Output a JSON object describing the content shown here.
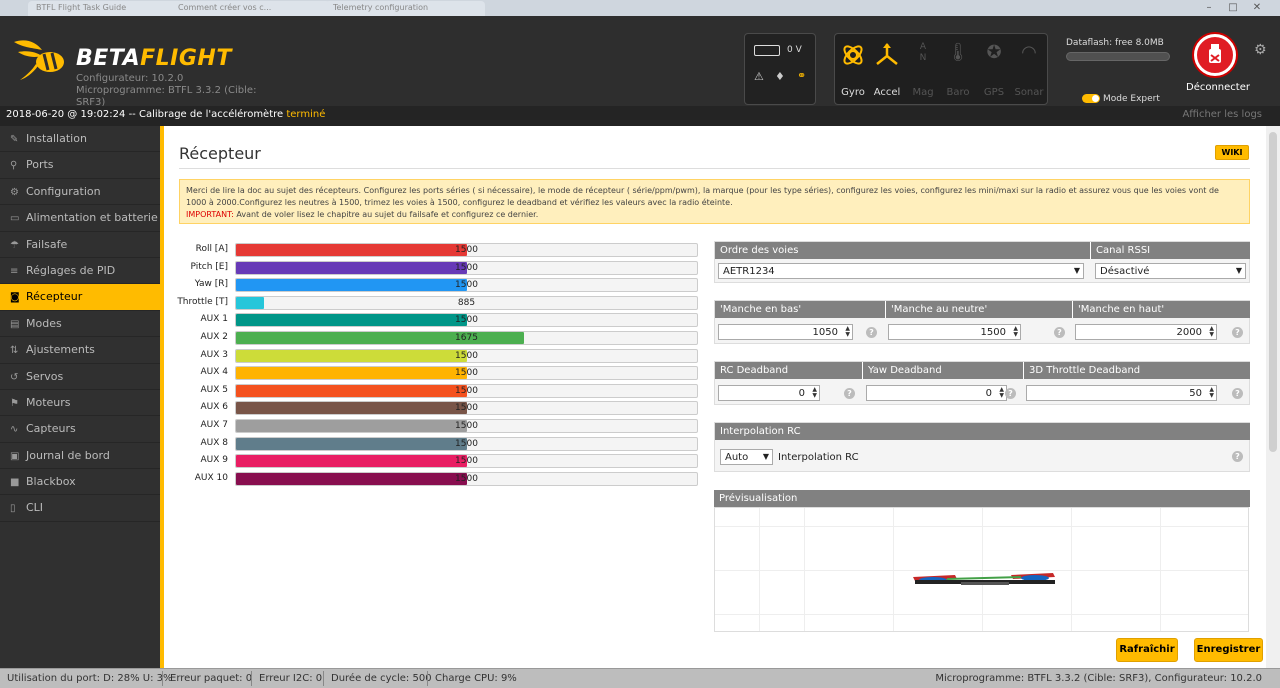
{
  "window_tabs": [
    "BTFL Flight Task Guide",
    "Comment créer vos c...",
    "Telemetry configuration"
  ],
  "header": {
    "logo_prefix": "BETA",
    "logo_suffix": "FLIGHT",
    "configurator": "Configurateur: 10.2.0",
    "firmware_line1": "Microprogramme: BTFL 3.3.2 (Cible:",
    "firmware_line2": "SRF3)",
    "battery_voltage": "0 V",
    "sensors": [
      {
        "label": "Gyro",
        "active": true
      },
      {
        "label": "Accel",
        "active": true
      },
      {
        "label": "Mag",
        "active": false
      },
      {
        "label": "Baro",
        "active": false
      },
      {
        "label": "GPS",
        "active": false
      },
      {
        "label": "Sonar",
        "active": false
      }
    ],
    "dataflash": "Dataflash: free 8.0MB",
    "expert_mode": "Mode Expert",
    "disconnect": "Déconnecter"
  },
  "logbar": {
    "text": "2018-06-20 @ 19:02:24 -- Calibrage de l'accéléromètre ",
    "highlight": "terminé",
    "show_logs": "Afficher les logs"
  },
  "sidebar": [
    {
      "label": "Installation",
      "icon": "wrench-icon",
      "glyph": "✎"
    },
    {
      "label": "Ports",
      "icon": "plug-icon",
      "glyph": "⚲"
    },
    {
      "label": "Configuration",
      "icon": "gear-icon",
      "glyph": "⚙"
    },
    {
      "label": "Alimentation et batterie",
      "icon": "battery-icon",
      "glyph": "▭"
    },
    {
      "label": "Failsafe",
      "icon": "parachute-icon",
      "glyph": "☂"
    },
    {
      "label": "Réglages de PID",
      "icon": "sliders-icon",
      "glyph": "≡"
    },
    {
      "label": "Récepteur",
      "icon": "receiver-icon",
      "glyph": "◙",
      "active": true
    },
    {
      "label": "Modes",
      "icon": "modes-icon",
      "glyph": "▤"
    },
    {
      "label": "Ajustements",
      "icon": "adjust-icon",
      "glyph": "⇅"
    },
    {
      "label": "Servos",
      "icon": "servo-icon",
      "glyph": "↺"
    },
    {
      "label": "Moteurs",
      "icon": "motor-icon",
      "glyph": "⚑"
    },
    {
      "label": "Capteurs",
      "icon": "sensor-icon",
      "glyph": "∿"
    },
    {
      "label": "Journal de bord",
      "icon": "log-icon",
      "glyph": "▣"
    },
    {
      "label": "Blackbox",
      "icon": "blackbox-icon",
      "glyph": "■"
    },
    {
      "label": "CLI",
      "icon": "terminal-icon",
      "glyph": "▯"
    }
  ],
  "page": {
    "title": "Récepteur",
    "wiki": "WIKI",
    "note_line1": "Merci de lire la doc au sujet des récepteurs. Configurez les ports séries ( si nécessaire), le mode de récepteur ( série/ppm/pwm), la marque (pour les type séries), configurez les voies, configurez les mini/maxi sur la radio et assurez vous que les voies vont de",
    "note_line2": "1000 à 2000.Configurez les neutres à 1500, trimez les voies à 1500, configurez le deadband et vérifiez les valeurs avec la radio éteinte.",
    "note_important": "IMPORTANT:",
    "note_line3": " Avant de voler lisez le chapitre au sujet du failsafe et configurez ce dernier."
  },
  "channels": [
    {
      "label": "Roll [A]",
      "value": 1500,
      "color": "#e53935"
    },
    {
      "label": "Pitch [E]",
      "value": 1500,
      "color": "#673ab7"
    },
    {
      "label": "Yaw [R]",
      "value": 1500,
      "color": "#2196f3"
    },
    {
      "label": "Throttle [T]",
      "value": 885,
      "color": "#26c6da"
    },
    {
      "label": "AUX 1",
      "value": 1500,
      "color": "#009688"
    },
    {
      "label": "AUX 2",
      "value": 1675,
      "color": "#4caf50"
    },
    {
      "label": "AUX 3",
      "value": 1500,
      "color": "#cddc39"
    },
    {
      "label": "AUX 4",
      "value": 1500,
      "color": "#ffb300"
    },
    {
      "label": "AUX 5",
      "value": 1500,
      "color": "#f4511e"
    },
    {
      "label": "AUX 6",
      "value": 1500,
      "color": "#795548"
    },
    {
      "label": "AUX 7",
      "value": 1500,
      "color": "#9e9e9e"
    },
    {
      "label": "AUX 8",
      "value": 1500,
      "color": "#607d8b"
    },
    {
      "label": "AUX 9",
      "value": 1500,
      "color": "#e91e63"
    },
    {
      "label": "AUX 10",
      "value": 1500,
      "color": "#880e4f"
    }
  ],
  "channel_range": [
    800,
    2200
  ],
  "rc": {
    "order_header": "Ordre des voies",
    "order_value": "AETR1234",
    "rssi_header": "Canal RSSI",
    "rssi_value": "Désactivé",
    "stick_low_header": "'Manche en bas'",
    "stick_low": "1050",
    "stick_center_header": "'Manche au neutre'",
    "stick_center": "1500",
    "stick_high_header": "'Manche en haut'",
    "stick_high": "2000",
    "rc_deadband_header": "RC Deadband",
    "rc_deadband": "0",
    "yaw_deadband_header": "Yaw Deadband",
    "yaw_deadband": "0",
    "throttle3d_header": "3D Throttle Deadband",
    "throttle3d": "50",
    "interp_header": "Interpolation RC",
    "interp_value": "Auto",
    "interp_label": "Interpolation RC",
    "preview_header": "Prévisualisation"
  },
  "buttons": {
    "refresh": "Rafraîchir",
    "save": "Enregistrer"
  },
  "status": {
    "port": "Utilisation du port: D: 28% U: 3%",
    "packet": "Erreur paquet: 0",
    "i2c": "Erreur I2C: 0",
    "cycle": "Durée de cycle: 500",
    "cpu": "Charge CPU: 9%",
    "version": "Microprogramme: BTFL 3.3.2 (Cible: SRF3), Configurateur: 10.2.0"
  }
}
